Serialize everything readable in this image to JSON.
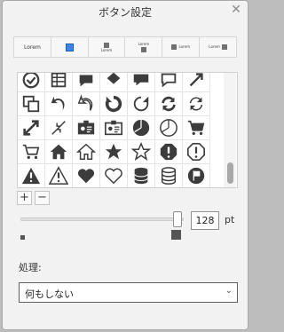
{
  "window": {
    "title": "ボタン設定"
  },
  "style_strip": {
    "cells": [
      {
        "label": "Lorem"
      },
      {
        "label": ""
      },
      {
        "label": "Lorem"
      },
      {
        "label": "Lorem"
      },
      {
        "label": "Lorem"
      },
      {
        "label": "Lorem"
      }
    ]
  },
  "icons": [
    "check-circle-icon",
    "list-icon",
    "chat-bubble-icon",
    "share-icon",
    "speech-bubble-icon",
    "chat-icon",
    "expand-arrow-icon",
    "copy-icon",
    "arrow-back-up-icon",
    "arrow-back-up-outline-icon",
    "rotate-ccw-icon",
    "rotate-cw-icon",
    "sync-icon",
    "sync-outline-icon",
    "resize-arrows-icon",
    "shrink-arrows-icon",
    "id-card-icon",
    "id-card-outline-icon",
    "pie-chart-icon",
    "clock-pie-icon",
    "cart-icon",
    "cart-outline-icon",
    "home-icon",
    "home-outline-icon",
    "star-icon",
    "star-outline-icon",
    "alert-hexagon-icon",
    "alert-hexagon-outline-icon",
    "warning-icon",
    "warning-outline-icon",
    "heart-icon",
    "heart-outline-icon",
    "database-icon",
    "database-outline-icon",
    "flag-circle-icon"
  ],
  "controls": {
    "add_label": "+",
    "remove_label": "−",
    "size_value": "128",
    "size_unit": "pt",
    "size_fraction": 0.96
  },
  "action": {
    "label": "処理:",
    "selected": "何もしない"
  },
  "colors": {
    "accent_blue": "#3a86e8",
    "icon_dark": "#3c3c3c"
  }
}
